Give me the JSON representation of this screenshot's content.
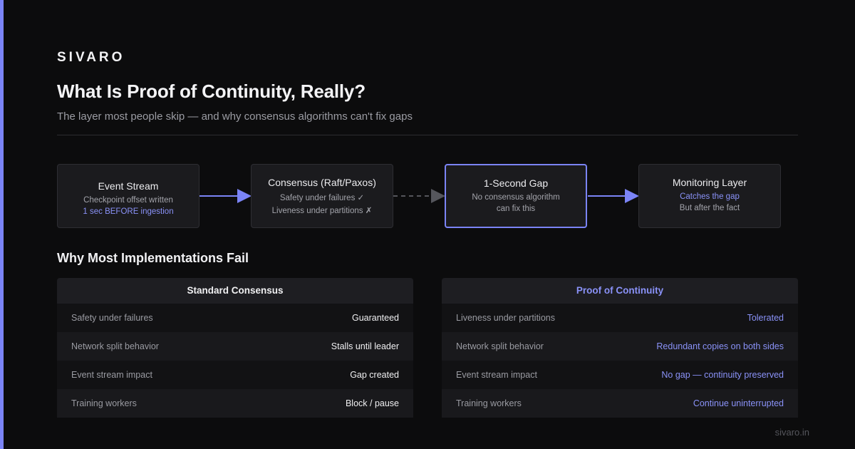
{
  "brand": "SIVARO",
  "title": "What Is Proof of Continuity, Really?",
  "subtitle": "The layer most people skip — and why consensus algorithms can't fix gaps",
  "colors": {
    "accent": "#7b84f6",
    "background": "#0c0c0d",
    "box": "#1b1b1e"
  },
  "flow": [
    {
      "title": "Event Stream",
      "lines": [
        "Checkpoint offset written",
        "1 sec BEFORE ingestion"
      ]
    },
    {
      "title": "Consensus (Raft/Paxos)",
      "lines": [
        "Safety under failures ✓",
        "Liveness under partitions ✗"
      ]
    },
    {
      "title": "1-Second Gap",
      "lines": [
        "No consensus algorithm",
        "can fix this"
      ]
    },
    {
      "title": "Monitoring Layer",
      "lines": [
        "Catches the gap",
        "But after the fact"
      ]
    }
  ],
  "section_title": "Why Most Implementations Fail",
  "tables": {
    "standard": {
      "header": "Standard Consensus",
      "rows": [
        {
          "k": "Safety under failures",
          "v": "Guaranteed"
        },
        {
          "k": "Network split behavior",
          "v": "Stalls until leader"
        },
        {
          "k": "Event stream impact",
          "v": "Gap created"
        },
        {
          "k": "Training workers",
          "v": "Block / pause"
        }
      ]
    },
    "poc": {
      "header": "Proof of Continuity",
      "rows": [
        {
          "k": "Liveness under partitions",
          "v": "Tolerated"
        },
        {
          "k": "Network split behavior",
          "v": "Redundant copies on both sides"
        },
        {
          "k": "Event stream impact",
          "v": "No gap — continuity preserved"
        },
        {
          "k": "Training workers",
          "v": "Continue uninterrupted"
        }
      ]
    }
  },
  "footer": "sivaro.in"
}
